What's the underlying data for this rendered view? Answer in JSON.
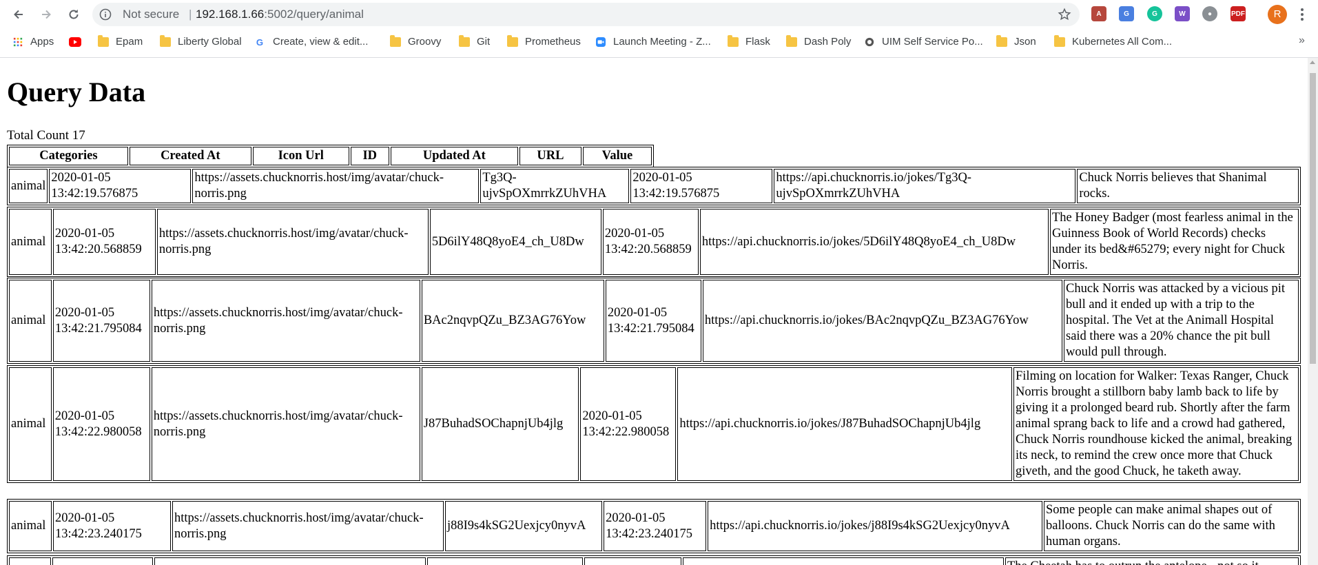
{
  "browser": {
    "security_label": "Not secure",
    "url_host": "192.168.1.66",
    "url_rest": ":5002/query/animal",
    "profile_initial": "R"
  },
  "bookmarks": [
    {
      "label": "Apps",
      "icon": "apps-grid-icon"
    },
    {
      "label": "",
      "icon": "youtube-icon"
    },
    {
      "label": "Epam",
      "icon": "folder-icon"
    },
    {
      "label": "Liberty Global",
      "icon": "folder-icon"
    },
    {
      "label": "Create, view & edit...",
      "icon": "google-icon"
    },
    {
      "label": "Groovy",
      "icon": "folder-icon"
    },
    {
      "label": "Git",
      "icon": "folder-icon"
    },
    {
      "label": "Prometheus",
      "icon": "folder-icon"
    },
    {
      "label": "Launch Meeting - Z...",
      "icon": "zoom-icon"
    },
    {
      "label": "Flask",
      "icon": "folder-icon"
    },
    {
      "label": "Dash Poly",
      "icon": "folder-icon"
    },
    {
      "label": "UIM Self Service Po...",
      "icon": "uim-icon"
    },
    {
      "label": "Json",
      "icon": "folder-icon"
    },
    {
      "label": "Kubernetes All Com...",
      "icon": "folder-icon"
    }
  ],
  "page": {
    "title": "Query Data",
    "total_label": "Total Count 17"
  },
  "headers": [
    "Categories",
    "Created At",
    "Icon Url",
    "ID",
    "Updated At",
    "URL",
    "Value"
  ],
  "rows": [
    {
      "category": "animal",
      "created_at": "2020-01-05 13:42:19.576875",
      "icon_url": "https://assets.chucknorris.host/img/avatar/chuck-norris.png",
      "id": "Tg3Q-ujvSpOXmrrkZUhVHA",
      "updated_at": "2020-01-05 13:42:19.576875",
      "url": "https://api.chucknorris.io/jokes/Tg3Q-ujvSpOXmrrkZUhVHA",
      "value": "Chuck Norris believes that Shanimal rocks."
    },
    {
      "category": "animal",
      "created_at": "2020-01-05 13:42:20.568859",
      "icon_url": "https://assets.chucknorris.host/img/avatar/chuck-norris.png",
      "id": "5D6ilY48Q8yoE4_ch_U8Dw",
      "updated_at": "2020-01-05 13:42:20.568859",
      "url": "https://api.chucknorris.io/jokes/5D6ilY48Q8yoE4_ch_U8Dw",
      "value": "The Honey Badger (most fearless animal in the Guinness Book of World Records) checks under its bed&#65279; every night for Chuck Norris."
    },
    {
      "category": "animal",
      "created_at": "2020-01-05 13:42:21.795084",
      "icon_url": "https://assets.chucknorris.host/img/avatar/chuck-norris.png",
      "id": "BAc2nqvpQZu_BZ3AG76Yow",
      "updated_at": "2020-01-05 13:42:21.795084",
      "url": "https://api.chucknorris.io/jokes/BAc2nqvpQZu_BZ3AG76Yow",
      "value": "Chuck Norris was attacked by a vicious pit bull and it ended up with a trip to the hospital. The Vet at the Animall Hospital said there was a 20% chance the pit bull would pull through."
    },
    {
      "category": "animal",
      "created_at": "2020-01-05 13:42:22.980058",
      "icon_url": "https://assets.chucknorris.host/img/avatar/chuck-norris.png",
      "id": "J87BuhadSOChapnjUb4jlg",
      "updated_at": "2020-01-05 13:42:22.980058",
      "url": "https://api.chucknorris.io/jokes/J87BuhadSOChapnjUb4jlg",
      "value": "Filming on location for Walker: Texas Ranger, Chuck Norris brought a stillborn baby lamb back to life by giving it a prolonged beard rub. Shortly after the farm animal sprang back to life and a crowd had gathered, Chuck Norris roundhouse kicked the animal, breaking its neck, to remind the crew once more that Chuck giveth, and the good Chuck, he taketh away."
    },
    {
      "category": "animal",
      "created_at": "2020-01-05 13:42:23.240175",
      "icon_url": "https://assets.chucknorris.host/img/avatar/chuck-norris.png",
      "id": "j88I9s4kSG2Uexjcy0nyvA",
      "updated_at": "2020-01-05 13:42:23.240175",
      "url": "https://api.chucknorris.io/jokes/j88I9s4kSG2Uexjcy0nyvA",
      "value": "Some people can make animal shapes out of balloons. Chuck Norris can do the same with human organs."
    },
    {
      "category": "",
      "created_at": "",
      "icon_url": "",
      "id": "",
      "updated_at": "",
      "url": "",
      "value": "The Cheetah has to outrun the antelope - not so it"
    }
  ]
}
